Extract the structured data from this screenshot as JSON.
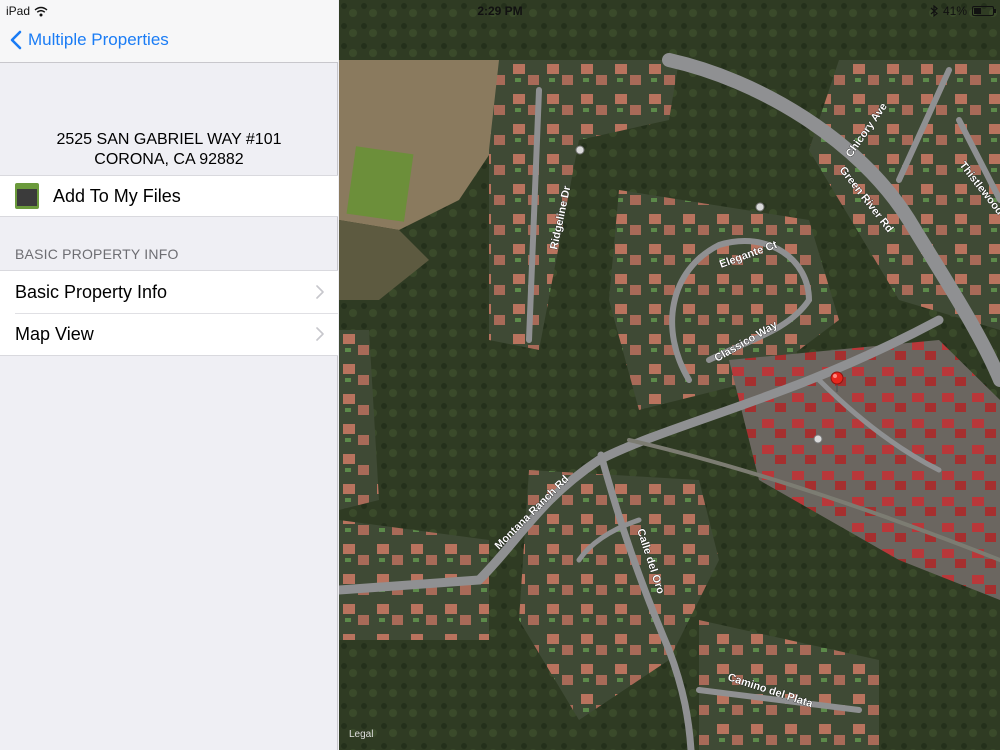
{
  "status_bar": {
    "device": "iPad",
    "time": "2:29 PM",
    "battery_percent_label": "41%",
    "battery_level": 0.41
  },
  "nav": {
    "back_label": "Multiple Properties"
  },
  "property": {
    "address_line1": "2525 SAN GABRIEL WAY #101",
    "address_line2": "CORONA, CA 92882"
  },
  "actions": {
    "add_to_files": "Add To My Files"
  },
  "section": {
    "header": "BASIC PROPERTY INFO",
    "items": [
      {
        "label": "Basic Property Info"
      },
      {
        "label": "Map View"
      }
    ]
  },
  "map": {
    "streets": [
      "Ridgeline Dr",
      "Chicory Ave",
      "Green River Rd",
      "Thistlewood",
      "Elegante Ct",
      "Classico Way",
      "Montana Ranch Rd",
      "Calle del Oro",
      "Camino del Plata"
    ],
    "legal": "Legal",
    "pin_color": "#e8261c"
  },
  "colors": {
    "accent": "#1a7cf5"
  }
}
